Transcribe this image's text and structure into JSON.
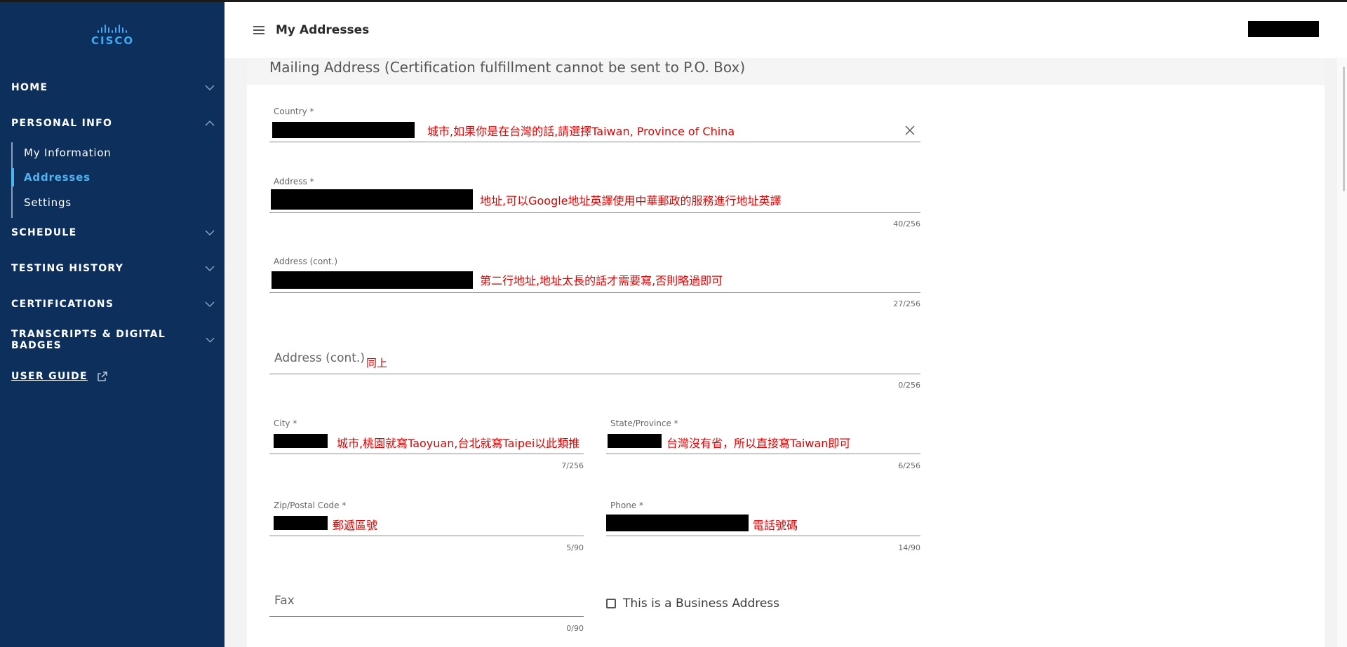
{
  "brand": {
    "logo_text": "CISCO"
  },
  "sidebar": {
    "items": [
      {
        "label": "HOME",
        "expanded": false
      },
      {
        "label": "PERSONAL INFO",
        "expanded": true
      },
      {
        "label": "SCHEDULE",
        "expanded": false
      },
      {
        "label": "TESTING HISTORY",
        "expanded": false
      },
      {
        "label": "CERTIFICATIONS",
        "expanded": false
      },
      {
        "label": "TRANSCRIPTS & DIGITAL BADGES",
        "expanded": false
      }
    ],
    "sub_items": [
      {
        "label": "My Information",
        "active": false
      },
      {
        "label": "Addresses",
        "active": true
      },
      {
        "label": "Settings",
        "active": false
      }
    ],
    "user_guide": "USER GUIDE"
  },
  "header": {
    "title": "My Addresses"
  },
  "form": {
    "section_title": "Mailing Address (Certification fulfillment cannot be sent to P.O. Box)",
    "country": {
      "label": "Country *",
      "note": "城市,如果你是在台灣的話,請選擇Taiwan, Province of China"
    },
    "address1": {
      "label": "Address *",
      "note": "地址,可以Google地址英譯使用中華郵政的服務進行地址英譯",
      "counter": "40/256"
    },
    "address2": {
      "label": "Address (cont.)",
      "note": "第二行地址,地址太長的話才需要寫,否則略過即可",
      "counter": "27/256"
    },
    "address3": {
      "placeholder": "Address (cont.)",
      "note": "同上",
      "counter": "0/256"
    },
    "city": {
      "label": "City *",
      "note": "城市,桃園就寫Taoyuan,台北就寫Taipei以此類推",
      "counter": "7/256"
    },
    "state": {
      "label": "State/Province *",
      "note": "台灣沒有省，所以直接寫Taiwan即可",
      "counter": "6/256"
    },
    "zip": {
      "label": "Zip/Postal Code *",
      "note": "郵遞區號",
      "counter": "5/90"
    },
    "phone": {
      "label": "Phone *",
      "note": "電話號碼",
      "counter": "14/90"
    },
    "fax": {
      "placeholder": "Fax",
      "counter": "0/90"
    },
    "business": {
      "label": "This is a Business Address",
      "checked": false
    }
  },
  "colors": {
    "sidebar_bg": "#0d2f5c",
    "accent": "#4fb3f0",
    "annotation": "#e00000"
  }
}
